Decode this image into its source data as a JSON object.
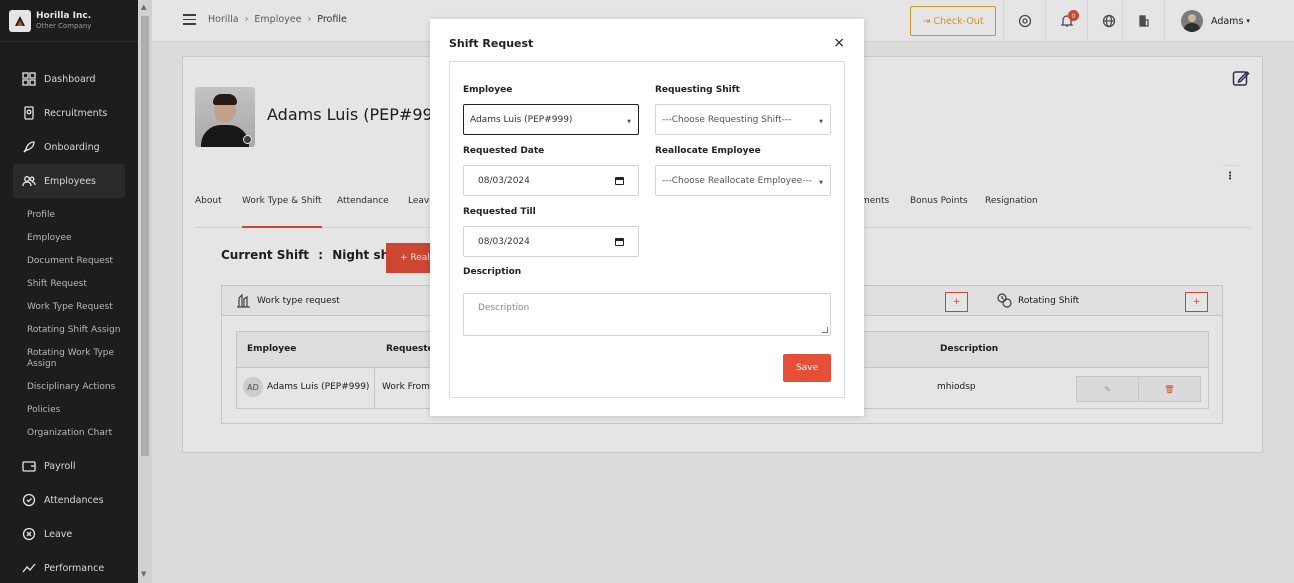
{
  "brand": {
    "name": "Horilla Inc.",
    "sub": "Other Company"
  },
  "sidebar": {
    "items": [
      {
        "label": "Dashboard",
        "icon": "dashboard-icon"
      },
      {
        "label": "Recruitments",
        "icon": "recruitment-icon"
      },
      {
        "label": "Onboarding",
        "icon": "rocket-icon"
      },
      {
        "label": "Employees",
        "icon": "users-icon"
      }
    ],
    "sub_items": [
      "Profile",
      "Employee",
      "Document Request",
      "Shift Request",
      "Work Type Request",
      "Rotating Shift Assign",
      "Rotating Work Type Assign",
      "Disciplinary Actions",
      "Policies",
      "Organization Chart"
    ],
    "bottom_items": [
      {
        "label": "Payroll",
        "icon": "wallet-icon"
      },
      {
        "label": "Attendances",
        "icon": "clock-icon"
      },
      {
        "label": "Leave",
        "icon": "leave-icon"
      },
      {
        "label": "Performance",
        "icon": "chart-line-icon"
      }
    ]
  },
  "header": {
    "breadcrumbs": [
      "Horilla",
      "Employee",
      "Profile"
    ],
    "checkout_label": "Check-Out",
    "notif_count": "0",
    "user_name": "Adams"
  },
  "profile": {
    "name": "Adams Luis (PEP#999)",
    "tabs": [
      "About",
      "Work Type & Shift",
      "Attendance",
      "Leave",
      "ments",
      "Bonus Points",
      "Resignation"
    ],
    "current_shift_label": "Current Shift",
    "current_shift_sep": ":",
    "current_shift_value": "Night shift",
    "reallocate_label": "+ Reall",
    "work_type_title": "Work type request",
    "rotating_title": "Rotating Shift",
    "plus": "+",
    "table": {
      "headers": [
        "Employee",
        "Requested",
        "Description"
      ],
      "row": {
        "initials": "AD",
        "employee": "Adams Luis (PEP#999)",
        "requested": "Work From",
        "description": "mhiodsp"
      }
    }
  },
  "modal": {
    "title": "Shift Request",
    "close": "×",
    "employee_label": "Employee",
    "employee_value": "Adams Luis (PEP#999)",
    "requesting_shift_label": "Requesting Shift",
    "requesting_shift_value": "---Choose Requesting Shift---",
    "requested_date_label": "Requested Date",
    "requested_date_value": "08/03/2024",
    "reallocate_label": "Reallocate Employee",
    "reallocate_value": "---Choose Reallocate Employee---",
    "requested_till_label": "Requested Till",
    "requested_till_value": "08/03/2024",
    "description_label": "Description",
    "description_placeholder": "Description",
    "save_label": "Save"
  }
}
